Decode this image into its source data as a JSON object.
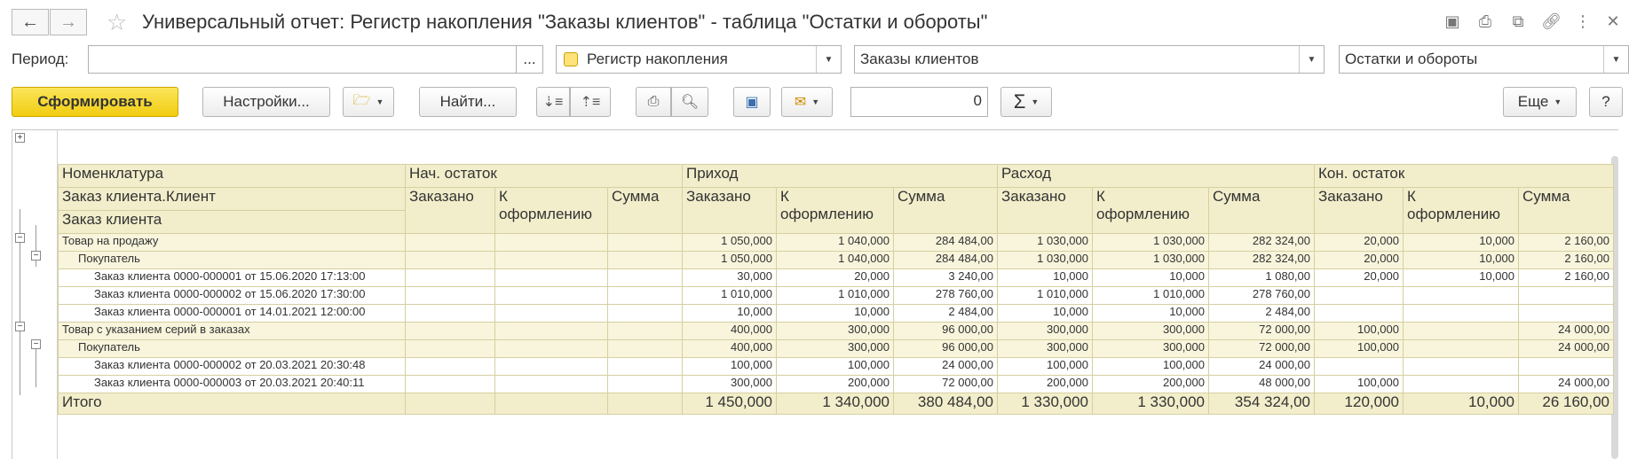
{
  "window": {
    "title": "Универсальный отчет: Регистр накопления \"Заказы клиентов\" - таблица \"Остатки и обороты\""
  },
  "filters": {
    "period_label": "Период:",
    "period_value": "",
    "dots": "...",
    "source_type": "Регистр накопления",
    "source": "Заказы клиентов",
    "table": "Остатки и обороты"
  },
  "toolbar": {
    "generate": "Сформировать",
    "settings": "Настройки...",
    "find": "Найти...",
    "sum_value": "0",
    "sigma": "Σ",
    "more": "Еще",
    "help": "?"
  },
  "report": {
    "headers": {
      "nomenclature": "Номенклатура",
      "client": "Заказ клиента.Клиент",
      "order": "Заказ клиента",
      "start_balance": "Нач. остаток",
      "income": "Приход",
      "expense": "Расход",
      "end_balance": "Кон. остаток",
      "ordered": "Заказано",
      "to_process_1": "К",
      "to_process_2": "оформлению",
      "sum": "Сумма"
    },
    "rows": [
      {
        "name": "Товар на продажу",
        "v": [
          "",
          "",
          "",
          "1 050,000",
          "1 040,000",
          "284 484,00",
          "1 030,000",
          "1 030,000",
          "282 324,00",
          "20,000",
          "10,000",
          "2 160,00"
        ]
      },
      {
        "name": "Покупатель",
        "v": [
          "",
          "",
          "",
          "1 050,000",
          "1 040,000",
          "284 484,00",
          "1 030,000",
          "1 030,000",
          "282 324,00",
          "20,000",
          "10,000",
          "2 160,00"
        ]
      },
      {
        "name": "Заказ клиента 0000-000001 от 15.06.2020 17:13:00",
        "v": [
          "",
          "",
          "",
          "30,000",
          "20,000",
          "3 240,00",
          "10,000",
          "10,000",
          "1 080,00",
          "20,000",
          "10,000",
          "2 160,00"
        ]
      },
      {
        "name": "Заказ клиента 0000-000002 от 15.06.2020 17:30:00",
        "v": [
          "",
          "",
          "",
          "1 010,000",
          "1 010,000",
          "278 760,00",
          "1 010,000",
          "1 010,000",
          "278 760,00",
          "",
          "",
          ""
        ]
      },
      {
        "name": "Заказ клиента 0000-000001 от 14.01.2021 12:00:00",
        "v": [
          "",
          "",
          "",
          "10,000",
          "10,000",
          "2 484,00",
          "10,000",
          "10,000",
          "2 484,00",
          "",
          "",
          ""
        ]
      },
      {
        "name": "Товар с указанием серий в заказах",
        "v": [
          "",
          "",
          "",
          "400,000",
          "300,000",
          "96 000,00",
          "300,000",
          "300,000",
          "72 000,00",
          "100,000",
          "",
          "24 000,00"
        ]
      },
      {
        "name": "Покупатель",
        "v": [
          "",
          "",
          "",
          "400,000",
          "300,000",
          "96 000,00",
          "300,000",
          "300,000",
          "72 000,00",
          "100,000",
          "",
          "24 000,00"
        ]
      },
      {
        "name": "Заказ клиента 0000-000002 от 20.03.2021 20:30:48",
        "v": [
          "",
          "",
          "",
          "100,000",
          "100,000",
          "24 000,00",
          "100,000",
          "100,000",
          "24 000,00",
          "",
          "",
          ""
        ]
      },
      {
        "name": "Заказ клиента 0000-000003 от 20.03.2021 20:40:11",
        "v": [
          "",
          "",
          "",
          "300,000",
          "200,000",
          "72 000,00",
          "200,000",
          "200,000",
          "48 000,00",
          "100,000",
          "",
          "24 000,00"
        ]
      }
    ],
    "total": {
      "name": "Итого",
      "v": [
        "",
        "",
        "",
        "1 450,000",
        "1 340,000",
        "380 484,00",
        "1 330,000",
        "1 330,000",
        "354 324,00",
        "120,000",
        "10,000",
        "26 160,00"
      ]
    }
  }
}
